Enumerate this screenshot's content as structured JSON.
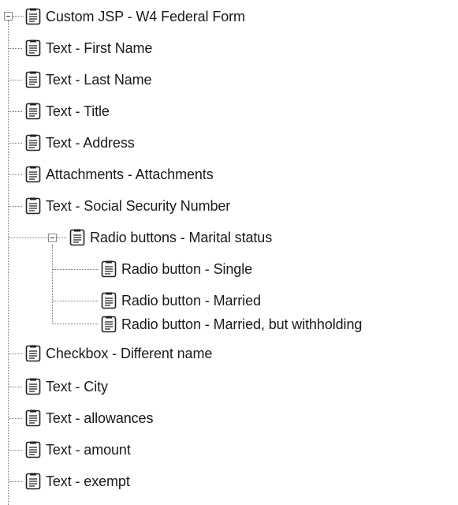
{
  "tree": {
    "root": {
      "label": "Custom JSP - W4 Federal Form",
      "icon": "document-icon",
      "expanded": true
    },
    "children": [
      {
        "label": "Text - First Name",
        "icon": "document-icon"
      },
      {
        "label": "Text - Last Name",
        "icon": "document-icon"
      },
      {
        "label": "Text - Title",
        "icon": "document-icon"
      },
      {
        "label": "Text - Address",
        "icon": "document-icon"
      },
      {
        "label": "Attachments - Attachments",
        "icon": "document-icon"
      },
      {
        "label": "Text - Social Security Number",
        "icon": "document-icon"
      },
      {
        "label": "Radio buttons - Marital status",
        "icon": "document-icon",
        "expanded": true,
        "children": [
          {
            "label": "Radio button - Single",
            "icon": "document-icon"
          },
          {
            "label": "Radio button - Married",
            "icon": "document-icon"
          },
          {
            "label": "Radio button - Married, but withholding",
            "icon": "document-icon"
          }
        ]
      },
      {
        "label": "Checkbox - Different name",
        "icon": "document-icon"
      },
      {
        "label": "Text - City",
        "icon": "document-icon"
      },
      {
        "label": "Text - allowances",
        "icon": "document-icon"
      },
      {
        "label": "Text - amount",
        "icon": "document-icon"
      },
      {
        "label": "Text - exempt",
        "icon": "document-icon"
      }
    ]
  }
}
